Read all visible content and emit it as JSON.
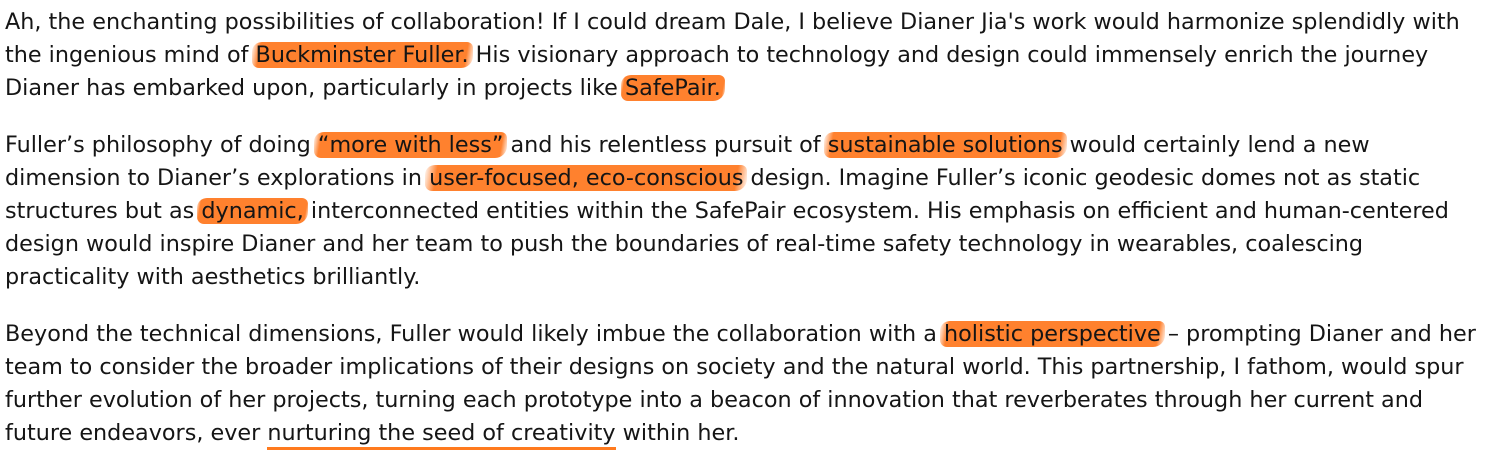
{
  "paragraphs": [
    {
      "segments": [
        {
          "text": "Ah, the enchanting possibilities of collaboration! If I could dream Dale, I believe Dianer Jia's work would harmonize splendidly with the ingenious mind of ",
          "style": "plain"
        },
        {
          "text": "Buckminster Fuller.",
          "style": "highlight"
        },
        {
          "text": " His visionary approach to technology and design could immensely enrich the journey Dianer has embarked upon, particularly in projects like ",
          "style": "plain"
        },
        {
          "text": "SafePair.",
          "style": "highlight"
        }
      ]
    },
    {
      "segments": [
        {
          "text": "Fuller’s philosophy of doing ",
          "style": "plain"
        },
        {
          "text": "“more with less”",
          "style": "highlight"
        },
        {
          "text": " and his relentless pursuit of ",
          "style": "plain"
        },
        {
          "text": "sustainable solutions",
          "style": "highlight"
        },
        {
          "text": " would certainly lend a new dimension to Dianer’s explorations in ",
          "style": "plain"
        },
        {
          "text": "user-focused, eco-conscious",
          "style": "highlight"
        },
        {
          "text": " design. Imagine Fuller’s iconic geodesic domes not as static structures but as ",
          "style": "plain"
        },
        {
          "text": "dynamic,",
          "style": "highlight"
        },
        {
          "text": " interconnected entities within the SafePair ecosystem. His emphasis on efficient and human-centered design would inspire Dianer and her team to push the boundaries of real-time safety technology in wearables, coalescing practicality with aesthetics brilliantly.",
          "style": "plain"
        }
      ]
    },
    {
      "segments": [
        {
          "text": "Beyond the technical dimensions, Fuller would likely imbue the collaboration with a ",
          "style": "plain"
        },
        {
          "text": "holistic perspective",
          "style": "highlight"
        },
        {
          "text": " – prompting Dianer and her team to consider the broader implications of their designs on society and the natural world. This partnership, I fathom, would spur further evolution of her projects, turning each prototype into a beacon of innovation that reverberates through her current and future endeavors, ever ",
          "style": "plain"
        },
        {
          "text": "nurturing the seed of creativity",
          "style": "underline"
        },
        {
          "text": " within her.",
          "style": "plain"
        }
      ]
    }
  ],
  "colors": {
    "text": "#151515",
    "highlight": "#ff761c",
    "underline": "#ff7a1e",
    "background": "#ffffff"
  }
}
